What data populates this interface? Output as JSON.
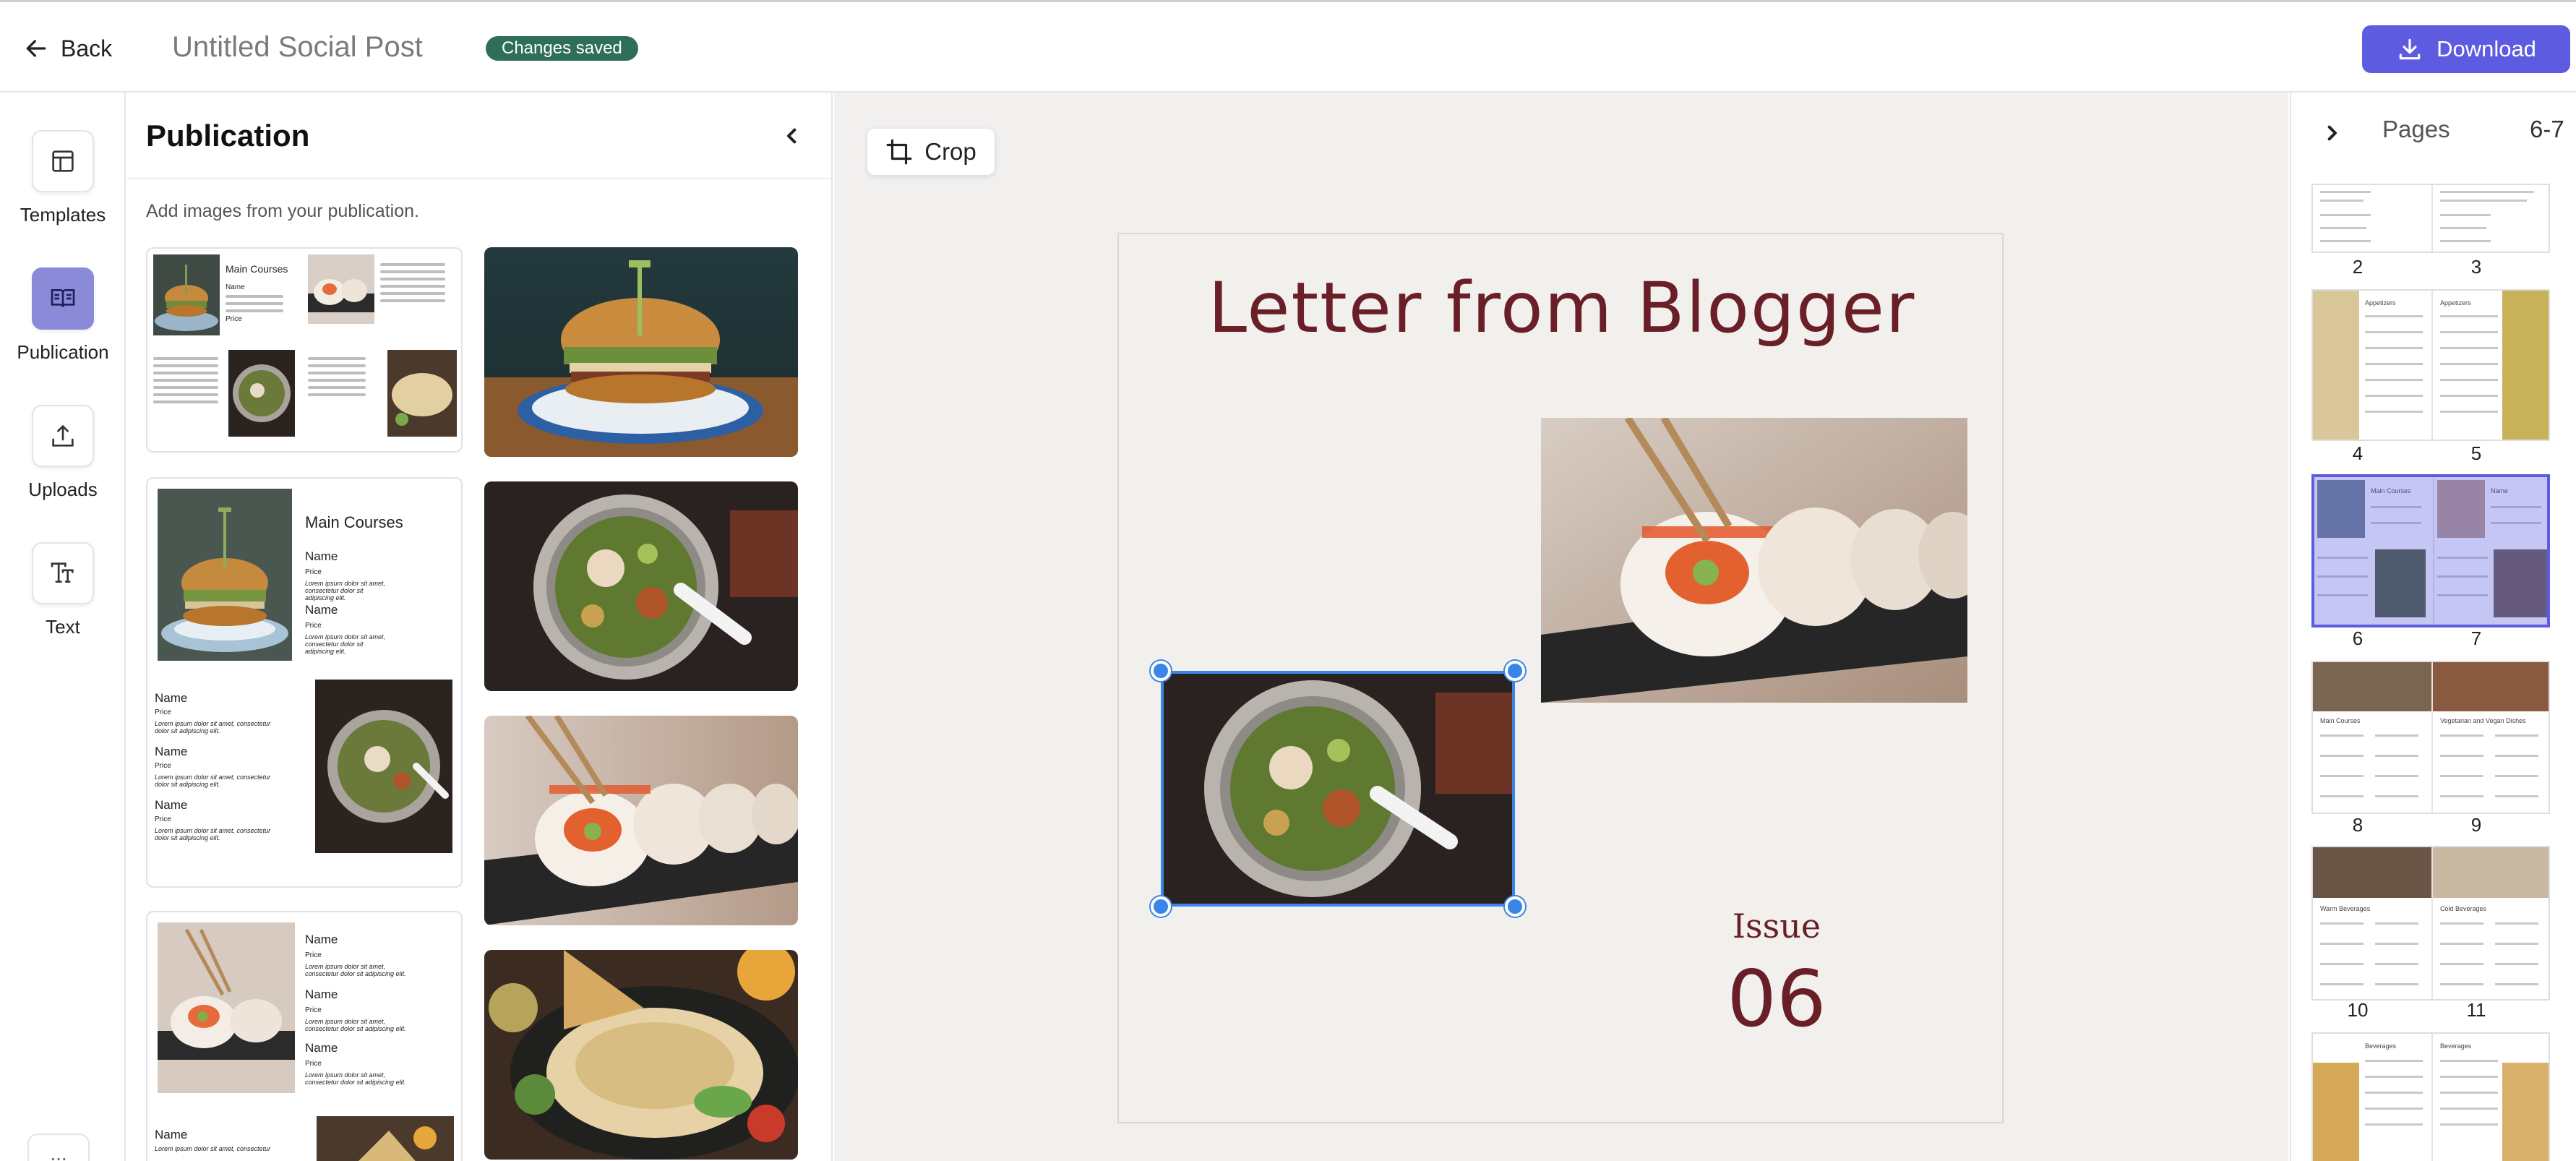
{
  "header": {
    "back_label": "Back",
    "doc_title": "Untitled Social Post",
    "status_badge": "Changes saved",
    "download_label": "Download"
  },
  "rail": {
    "items": [
      {
        "label": "Templates",
        "icon": "templates-icon"
      },
      {
        "label": "Publication",
        "icon": "publication-icon"
      },
      {
        "label": "Uploads",
        "icon": "upload-icon"
      },
      {
        "label": "Text",
        "icon": "text-icon"
      }
    ],
    "more_label": "..."
  },
  "publication": {
    "title": "Publication",
    "hint": "Add images from your publication.",
    "spread1": {
      "heading": "Main Courses",
      "name_label": "Name",
      "price_label": "Price"
    },
    "spread2": {
      "heading": "Main Courses",
      "entries": [
        {
          "name": "Name",
          "price": "Price",
          "desc": "Lorem ipsum dolor sit amet, consectetur dolor sit adipiscing elit."
        },
        {
          "name": "Name",
          "price": "Price",
          "desc": "Lorem ipsum dolor sit amet, consectetur dolor sit adipiscing elit."
        },
        {
          "name": "Name",
          "price": "Price",
          "desc": "Lorem ipsum dolor sit amet, consectetur dolor sit adipiscing elit."
        },
        {
          "name": "Name",
          "price": "Price",
          "desc": "Lorem ipsum dolor sit amet, consectetur dolor sit adipiscing elit."
        },
        {
          "name": "Name",
          "price": "Price",
          "desc": "Lorem ipsum dolor sit amet, consectetur dolor sit adipiscing elit."
        }
      ]
    },
    "spread3": {
      "entries": [
        {
          "name": "Name",
          "price": "Price",
          "desc": "Lorem ipsum dolor sit amet, consectetur dolor sit adipiscing elit."
        },
        {
          "name": "Name",
          "price": "Price",
          "desc": "Lorem ipsum dolor sit amet, consectetur dolor sit adipiscing elit."
        },
        {
          "name": "Name",
          "price": "Price",
          "desc": "Lorem ipsum dolor sit amet, consectetur dolor sit adipiscing elit."
        },
        {
          "name": "Name",
          "price": "",
          "desc": "Lorem ipsum dolor sit amet, consectetur"
        }
      ]
    },
    "photos": [
      "burger-photo",
      "salad-bowl-photo",
      "sushi-roll-photo",
      "omelette-plate-photo"
    ]
  },
  "canvas": {
    "crop_label": "Crop",
    "page_title": "Letter from Blogger",
    "issue_label": "Issue",
    "issue_number": "06"
  },
  "pages": {
    "title": "Pages",
    "range": "6-7",
    "thumbs": [
      {
        "left": "2",
        "right": "3"
      },
      {
        "left": "4",
        "right": "5",
        "left_heading": "Appetizers",
        "right_heading": "Appetizers"
      },
      {
        "left": "6",
        "right": "7",
        "left_heading": "Main Courses",
        "right_heading": "Name",
        "active": true
      },
      {
        "left": "8",
        "right": "9",
        "left_heading": "Main Courses",
        "right_heading": "Vegetarian and Vegan Dishes"
      },
      {
        "left": "10",
        "right": "11",
        "left_heading": "Warm Beverages",
        "right_heading": "Cold Beverages"
      },
      {
        "left_heading": "Beverages",
        "right_heading": "Beverages"
      }
    ]
  },
  "colors": {
    "accent": "#5d5ce0",
    "saved_badge": "#2e6e5a",
    "title_maroon": "#6a1f28",
    "selection": "#3a86e8"
  }
}
